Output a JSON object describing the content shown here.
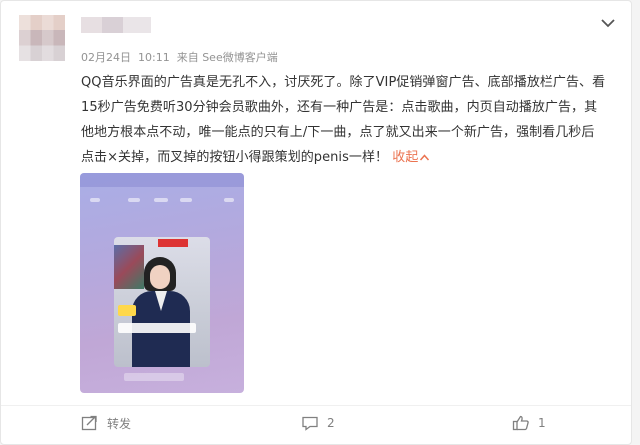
{
  "post": {
    "username": "",
    "date": "02月24日",
    "time": "10:11",
    "source": "来自 See微博客户端",
    "text": "QQ音乐界面的广告真是无孔不入，讨厌死了。除了VIP促销弹窗广告、底部播放栏广告、看15秒广告免费听30分钟会员歌曲外，还有一种广告是：点击歌曲，内页自动播放广告，其他地方根本点不动，唯一能点的只有上/下一曲，点了就又出来一个新广告，强制看几秒后点击×关掉，而叉掉的按钮小得跟策划的penis一样！",
    "collapse_label": "收起"
  },
  "actions": {
    "repost_label": "转发",
    "comment_count": "2",
    "like_count": "1"
  },
  "icons": {
    "menu": "chevron-down-icon",
    "collapse": "chevron-up-icon",
    "repost": "share-icon",
    "comment": "comment-icon",
    "like": "thumbs-up-icon"
  },
  "colors": {
    "link": "#eb7350",
    "meta_text": "#939393",
    "body_text": "#333333"
  }
}
